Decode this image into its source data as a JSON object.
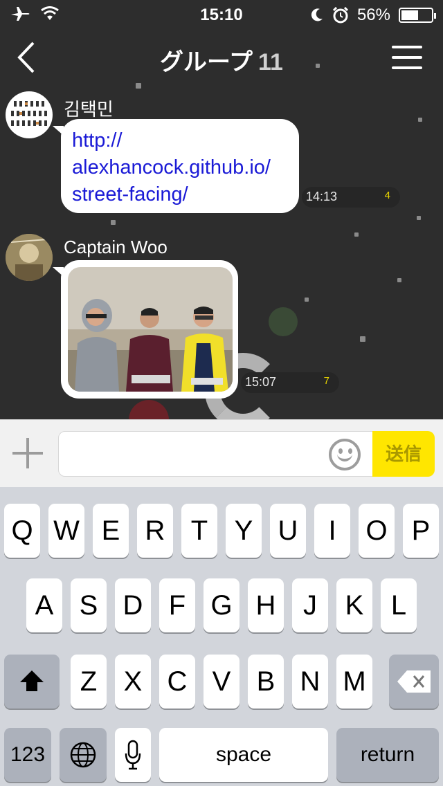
{
  "status_bar": {
    "time": "15:10",
    "battery": "56%",
    "battery_level": 0.56,
    "left_icons": [
      "airplane-icon",
      "wifi-icon"
    ],
    "right_icons": [
      "moon-icon",
      "alarm-icon",
      "battery-icon"
    ]
  },
  "nav": {
    "title": "グループ",
    "member_count": "11",
    "icons": [
      "back-chevron-icon",
      "menu-icon"
    ]
  },
  "messages": [
    {
      "sender": "김택민",
      "text_lines": [
        "http://",
        "alexhancock.github.io/",
        "street-facing/"
      ],
      "time": "14:13",
      "unread": "4"
    },
    {
      "sender": "Captain Woo",
      "attachment": "photo",
      "time": "15:07",
      "unread": "7"
    }
  ],
  "input": {
    "placeholder": "",
    "send_label": "送信",
    "icons": [
      "plus-icon",
      "emoji-icon"
    ]
  },
  "keyboard": {
    "row1": [
      "Q",
      "W",
      "E",
      "R",
      "T",
      "Y",
      "U",
      "I",
      "O",
      "P"
    ],
    "row2": [
      "A",
      "S",
      "D",
      "F",
      "G",
      "H",
      "J",
      "K",
      "L"
    ],
    "row3": [
      "Z",
      "X",
      "C",
      "V",
      "B",
      "N",
      "M"
    ],
    "numbers_label": "123",
    "space_label": "space",
    "return_label": "return",
    "icons": [
      "shift-icon",
      "backspace-icon",
      "globe-icon",
      "microphone-icon"
    ]
  },
  "colors": {
    "chat_bg": "#2d2d2d",
    "send_button": "#ffe600",
    "link": "#1a1ad6",
    "unread": "#e6d200"
  }
}
